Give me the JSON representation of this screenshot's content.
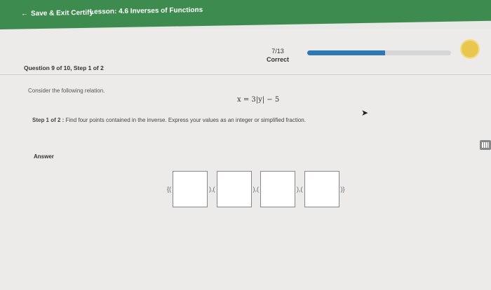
{
  "header": {
    "back_label": "Save & Exit Certify",
    "lesson_label": "Lesson: 4.6 Inverses of Functions"
  },
  "question": {
    "info": "Question 9 of 10, Step 1 of 2",
    "score": "7/13",
    "status": "Correct",
    "progress": 0.54
  },
  "problem": {
    "prompt": "Consider the following relation.",
    "equation": "x = 3|y| − 5",
    "step_label": "Step 1 of 2 :",
    "step_text": "Find four points contained in the inverse. Express your values as an integer or simplified fraction."
  },
  "answer": {
    "label": "Answer",
    "open": "{(",
    "sep1": "),(",
    "sep2": "),(",
    "sep3": "),(",
    "close": ")}"
  },
  "colors": {
    "topbar": "#3d8b4f",
    "progress": "#2f78b7",
    "badge": "#e9c64d"
  }
}
